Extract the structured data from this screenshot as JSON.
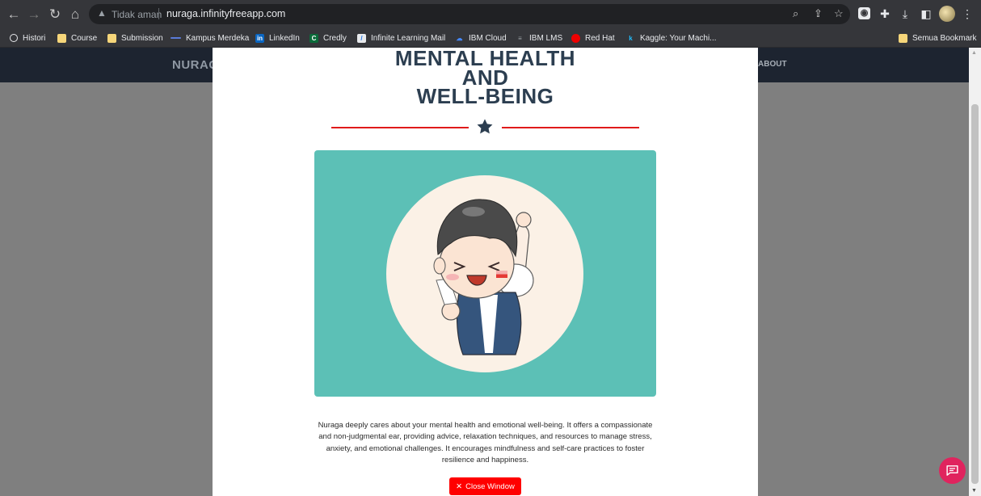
{
  "browser": {
    "security_label": "Tidak aman",
    "url": "nuraga.infinityfreeapp.com",
    "nav": {
      "back": "←",
      "forward": "→",
      "reload": "↻",
      "home": "⌂"
    },
    "icons": [
      "zoom-icon",
      "share-icon",
      "bookmark-star-icon",
      "extension-icon",
      "puzzle-icon",
      "download-icon",
      "side-panel-icon",
      "menu-icon"
    ]
  },
  "bookmarks": {
    "items": [
      {
        "label": "Histori"
      },
      {
        "label": "Course"
      },
      {
        "label": "Submission"
      },
      {
        "label": "Kampus Merdeka"
      },
      {
        "label": "LinkedIn"
      },
      {
        "label": "Credly"
      },
      {
        "label": "Infinite Learning Mail"
      },
      {
        "label": "IBM Cloud"
      },
      {
        "label": "IBM LMS"
      },
      {
        "label": "Red Hat"
      },
      {
        "label": "Kaggle: Your Machi..."
      }
    ],
    "all_bookmarks": "Semua Bookmark"
  },
  "site": {
    "brand": "NURAG",
    "nav_about": "ABOUT"
  },
  "modal": {
    "title_line1": "MENTAL HEALTH",
    "title_line2": "AND",
    "title_line3": "WELL-BEING",
    "description": "Nuraga deeply cares about your mental health and emotional well-being. It offers a compassionate and non-judgmental ear, providing advice, relaxation techniques, and resources to manage stress, anxiety, and emotional challenges. It encourages mindfulness and self-care practices to foster resilience and happiness.",
    "close_label": "Close Window",
    "close_glyph": "✕"
  },
  "colors": {
    "accent_red": "#ff0000",
    "title_navy": "#2c3e50",
    "teal": "#5cc0b6",
    "chat_pink": "#e0245e"
  }
}
